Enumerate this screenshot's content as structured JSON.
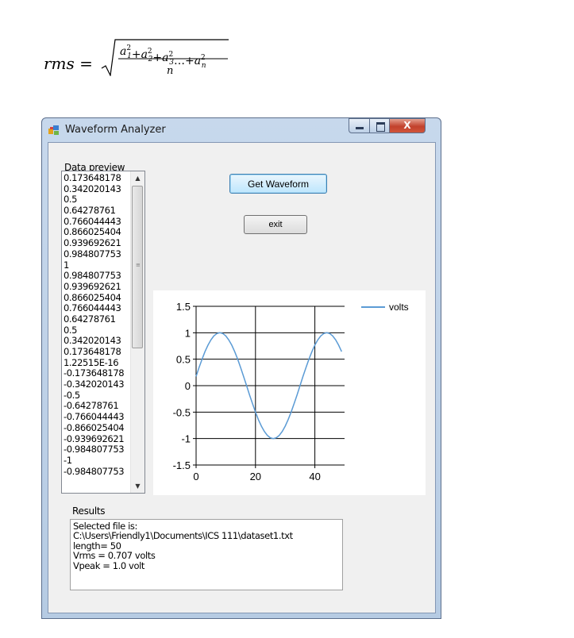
{
  "formula": {
    "lhs": "rms =",
    "numerator_terms": [
      "a",
      "1",
      "2",
      "+",
      "a",
      "2",
      "2",
      "+",
      "a",
      "3",
      "2",
      "…+",
      "a",
      "n",
      "2"
    ],
    "denominator": "n"
  },
  "window": {
    "title": "Waveform Analyzer",
    "close_glyph": "X"
  },
  "data_preview": {
    "label": "Data preview",
    "items": [
      "0.173648178",
      "0.342020143",
      "0.5",
      "0.64278761",
      "0.766044443",
      "0.866025404",
      "0.939692621",
      "0.984807753",
      "1",
      "0.984807753",
      "0.939692621",
      "0.866025404",
      "0.766044443",
      "0.64278761",
      "0.5",
      "0.342020143",
      "0.173648178",
      "1.22515E-16",
      "-0.173648178",
      "-0.342020143",
      "-0.5",
      "-0.64278761",
      "-0.766044443",
      "-0.866025404",
      "-0.939692621",
      "-0.984807753",
      "-1",
      "-0.984807753"
    ]
  },
  "buttons": {
    "get_waveform": "Get Waveform",
    "exit": "exit"
  },
  "chart_data": {
    "type": "line",
    "xlim": [
      0,
      50
    ],
    "ylim": [
      -1.5,
      1.5
    ],
    "x_ticks": [
      "0",
      "20",
      "40"
    ],
    "y_ticks": [
      "1.5",
      "1",
      "0.5",
      "0",
      "-0.5",
      "-1",
      "-1.5"
    ],
    "grid": true,
    "legend_position": "top-right",
    "series": [
      {
        "name": "volts",
        "color": "#5b9bd5",
        "x": [
          0,
          1,
          2,
          3,
          4,
          5,
          6,
          7,
          8,
          9,
          10,
          11,
          12,
          13,
          14,
          15,
          16,
          17,
          18,
          19,
          20,
          21,
          22,
          23,
          24,
          25,
          26,
          27,
          28,
          29,
          30,
          31,
          32,
          33,
          34,
          35,
          36,
          37,
          38,
          39,
          40,
          41,
          42,
          43,
          44,
          45,
          46,
          47,
          48,
          49
        ],
        "y": [
          0.174,
          0.342,
          0.5,
          0.643,
          0.766,
          0.866,
          0.94,
          0.985,
          1,
          0.985,
          0.94,
          0.866,
          0.766,
          0.643,
          0.5,
          0.342,
          0.174,
          0,
          -0.174,
          -0.342,
          -0.5,
          -0.643,
          -0.766,
          -0.866,
          -0.94,
          -0.985,
          -1,
          -0.985,
          -0.94,
          -0.866,
          -0.766,
          -0.643,
          -0.5,
          -0.342,
          -0.174,
          0,
          0.174,
          0.342,
          0.5,
          0.643,
          0.766,
          0.866,
          0.94,
          0.985,
          1,
          0.985,
          0.94,
          0.866,
          0.766,
          0.643
        ]
      }
    ]
  },
  "results": {
    "label": "Results",
    "lines": [
      "Selected file is:",
      "C:\\Users\\Friendly1\\Documents\\ICS 111\\dataset1.txt",
      "length= 50",
      "Vrms = 0.707 volts",
      "Vpeak = 1.0 volt"
    ]
  }
}
